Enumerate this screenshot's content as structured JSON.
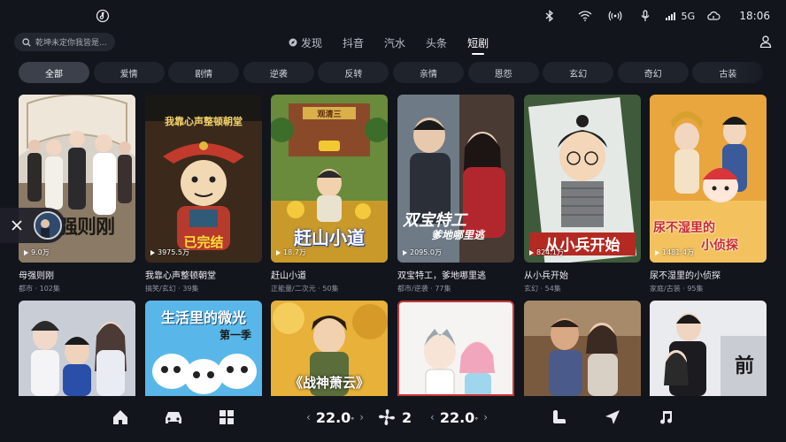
{
  "status": {
    "network": "5G",
    "time": "18:06",
    "left_icon": "music-note-icon"
  },
  "search": {
    "placeholder": "乾坤未定你我皆是..."
  },
  "nav": {
    "tabs": [
      "发现",
      "抖音",
      "汽水",
      "头条",
      "短剧"
    ],
    "active": 4
  },
  "chips": [
    "全部",
    "爱情",
    "剧情",
    "逆袭",
    "反转",
    "亲情",
    "恩怨",
    "玄幻",
    "奇幻",
    "古装"
  ],
  "row1": [
    {
      "title": "母强则刚",
      "meta": "都市 · 102集",
      "views": "9.0万",
      "poster_text": "母强则刚"
    },
    {
      "title": "我靠心声整顿朝堂",
      "meta": "搞笑/玄幻 · 39集",
      "views": "3975.5万",
      "poster_text": "我靠心声整顿朝堂",
      "poster_sub": "已完结"
    },
    {
      "title": "赶山小道",
      "meta": "正能量/二次元 · 50集",
      "views": "18.7万",
      "poster_text": "赶山小道",
      "poster_sign": "观清三"
    },
    {
      "title": "双宝特工，爹地哪里逃",
      "meta": "都市/逆袭 · 77集",
      "views": "2095.0万",
      "poster_text": "双宝特工",
      "poster_sub": "爹地哪里逃"
    },
    {
      "title": "从小兵开始",
      "meta": "玄幻 · 54集",
      "views": "824.1万",
      "poster_text": "从小兵开始"
    },
    {
      "title": "尿不湿里的小侦探",
      "meta": "家庭/古装 · 95集",
      "views": "1481.4万",
      "poster_text": "尿不湿里的",
      "poster_sub": "小侦探"
    }
  ],
  "row2": [
    {
      "poster_text": ""
    },
    {
      "poster_text": "生活里的微光",
      "poster_sub": "第一季"
    },
    {
      "poster_text": "《战神萧云》"
    },
    {
      "poster_text": ""
    },
    {
      "poster_text": ""
    },
    {
      "poster_text": "前"
    }
  ],
  "dock": {
    "temp_left": "22.0",
    "temp_right": "22.0",
    "fan_level": "2",
    "icons": [
      "home-icon",
      "car-icon",
      "apps-grid-icon",
      "fan-icon",
      "seat-icon",
      "navigation-icon",
      "music-icon"
    ]
  },
  "colors": {
    "background": "#12151c",
    "chip_bg": "#1f232c",
    "chip_active": "#3b404b"
  }
}
